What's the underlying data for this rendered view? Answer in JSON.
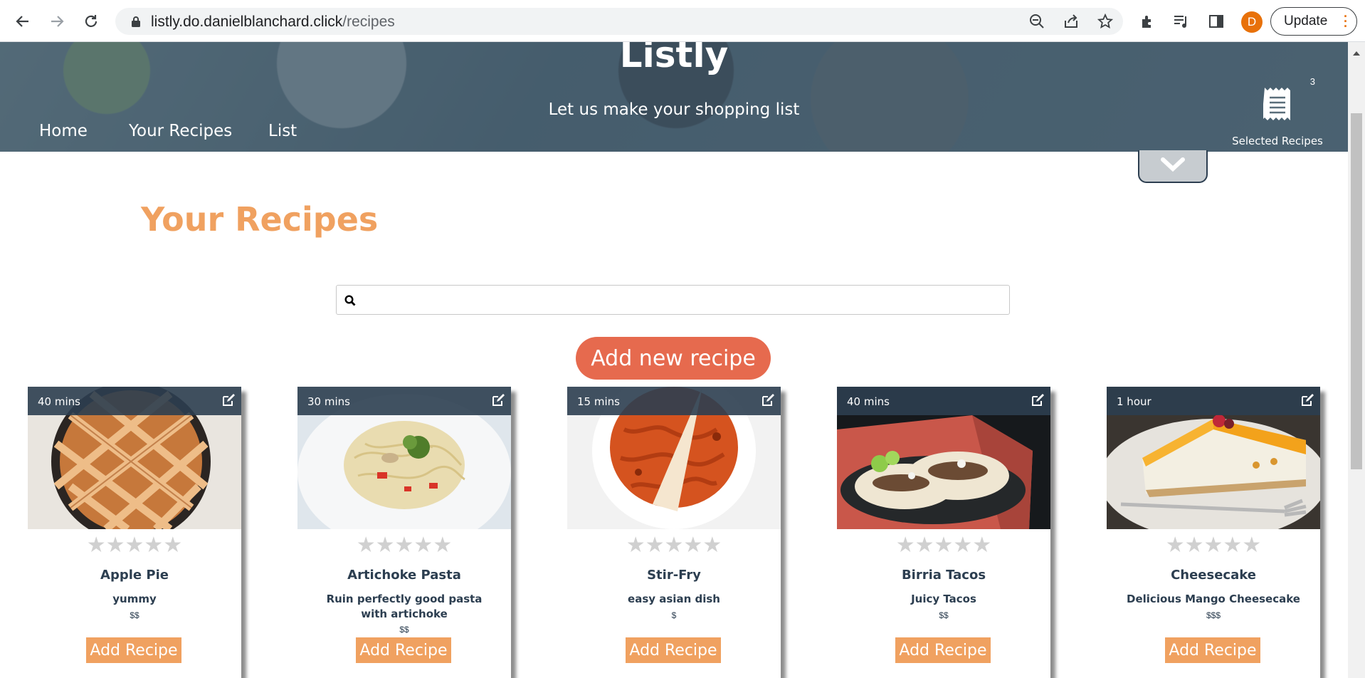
{
  "browser": {
    "url_host": "listly.do.danielblanchard.click",
    "url_path": "/recipes",
    "profile_initial": "D",
    "update_label": "Update",
    "icons": [
      "back-icon",
      "forward-icon",
      "reload-icon",
      "lock-icon",
      "zoom-icon",
      "share-icon",
      "star-icon",
      "extensions-icon",
      "media-icon",
      "side-panel-icon",
      "menu-dots-icon"
    ]
  },
  "hero": {
    "title": "Listly",
    "tagline": "Let us make your shopping list",
    "nav": [
      {
        "label": "Home"
      },
      {
        "label": "Your Recipes"
      },
      {
        "label": "List"
      }
    ],
    "selected": {
      "count": "3",
      "label": "Selected Recipes",
      "icon": "receipt-icon"
    }
  },
  "page": {
    "heading": "Your Recipes",
    "search_placeholder": "",
    "add_new_label": "Add new recipe"
  },
  "colors": {
    "accent_orange": "#f0a160",
    "button_red": "#e66a4e",
    "dark_blue": "#2c3e50"
  },
  "cards": [
    {
      "time": "40 mins",
      "name": "Apple Pie",
      "description": "yummy",
      "price": "$$",
      "rating": 0,
      "button": "Add Recipe",
      "image": "apple-pie"
    },
    {
      "time": "30 mins",
      "name": "Artichoke Pasta",
      "description": "Ruin perfectly good pasta with artichoke",
      "price": "$$",
      "rating": 0,
      "button": "Add Recipe",
      "image": "pasta"
    },
    {
      "time": "15 mins",
      "name": "Stir-Fry",
      "description": "easy asian dish",
      "price": "$",
      "rating": 0,
      "button": "Add Recipe",
      "image": "stir-fry"
    },
    {
      "time": "40 mins",
      "name": "Birria Tacos",
      "description": "Juicy Tacos",
      "price": "$$",
      "rating": 0,
      "button": "Add Recipe",
      "image": "tacos"
    },
    {
      "time": "1 hour",
      "name": "Cheesecake",
      "description": "Delicious Mango Cheesecake",
      "price": "$$$",
      "rating": 0,
      "button": "Add Recipe",
      "image": "cheesecake"
    }
  ]
}
